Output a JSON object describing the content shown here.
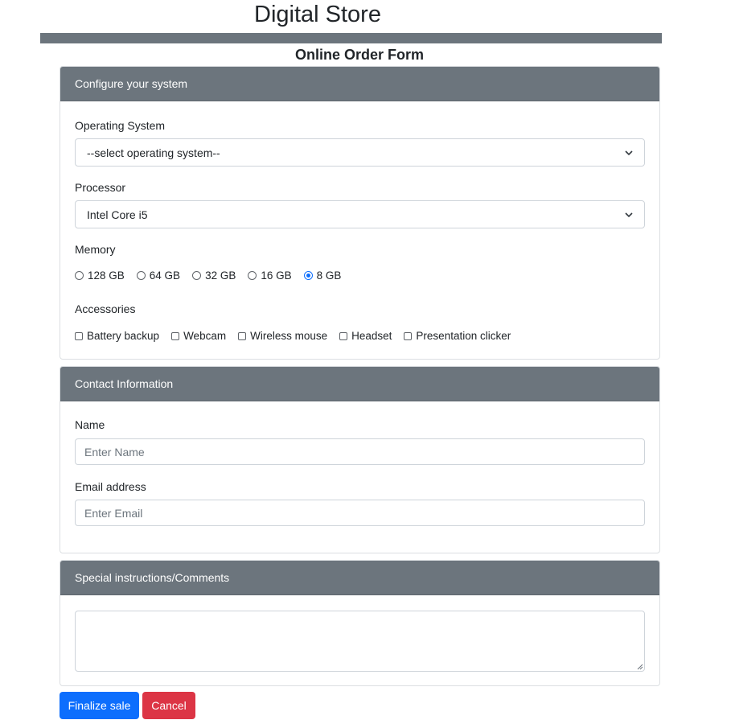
{
  "header": {
    "title": "Digital Store",
    "form_title": "Online Order Form"
  },
  "configure": {
    "header": "Configure your system",
    "os_label": "Operating System",
    "os_value": "--select operating system--",
    "processor_label": "Processor",
    "processor_value": "Intel Core i5",
    "memory_label": "Memory",
    "memory_options": [
      "128 GB",
      "64 GB",
      "32 GB",
      "16 GB",
      "8 GB"
    ],
    "memory_selected": "8 GB",
    "accessories_label": "Accessories",
    "accessories": [
      "Battery backup",
      "Webcam",
      "Wireless mouse",
      "Headset",
      "Presentation clicker"
    ]
  },
  "contact": {
    "header": "Contact Information",
    "name_label": "Name",
    "name_placeholder": "Enter Name",
    "email_label": "Email address",
    "email_placeholder": "Enter Email"
  },
  "comments": {
    "header": "Special instructions/Comments",
    "value": ""
  },
  "buttons": {
    "finalize": "Finalize sale",
    "cancel": "Cancel"
  },
  "colors": {
    "header_bg": "#6c757d",
    "primary": "#0d6efd",
    "danger": "#dc3545"
  },
  "icons": {
    "select_arrow": "chevron-down-icon",
    "resize_grip": "resize-grip-icon"
  }
}
